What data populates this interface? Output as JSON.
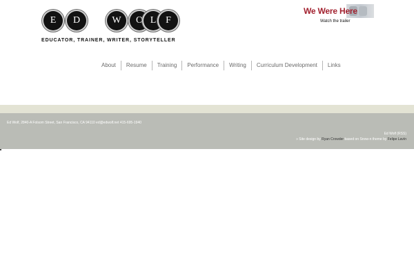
{
  "header": {
    "logo_letters": [
      "E",
      "D",
      "W",
      "O",
      "L",
      "F"
    ],
    "tagline": "EDUCATOR, TRAINER, WRITER, STORYTELLER",
    "trailer": {
      "title": "We Were Here",
      "link_text": "Watch the trailer",
      "title_color": "#a2212f"
    }
  },
  "nav": {
    "items": [
      "About",
      "Resume",
      "Training",
      "Performance",
      "Writing",
      "Curriculum Development",
      "Links"
    ]
  },
  "footer": {
    "address": "Ed Wolf, 2840-A Folsom Street, San Francisco, CA 94110 ed@edwolf.net 415-695-1940",
    "owner_rss": "Ed Wolf (RSS)",
    "design_prefix": "» Site design by",
    "designer": "Ryan Crowder",
    "based_on": "based on Snow-n theme by",
    "theme_author": "Felipe Lavín",
    "background_color": "#babcb6",
    "band_color": "#e3e3d4"
  }
}
